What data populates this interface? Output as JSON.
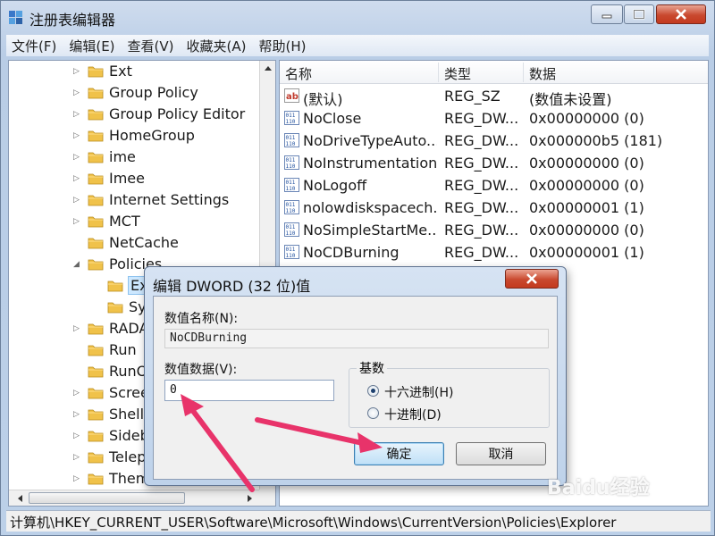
{
  "window": {
    "title": "注册表编辑器",
    "buttons": {
      "minimize": "minimize",
      "maximize": "maximize",
      "close": "close"
    }
  },
  "menu": [
    "文件(F)",
    "编辑(E)",
    "查看(V)",
    "收藏夹(A)",
    "帮助(H)"
  ],
  "tree": {
    "items": [
      {
        "label": "Ext",
        "expander": "▷"
      },
      {
        "label": "Group Policy",
        "expander": "▷"
      },
      {
        "label": "Group Policy Editor",
        "expander": "▷"
      },
      {
        "label": "HomeGroup",
        "expander": "▷"
      },
      {
        "label": "ime",
        "expander": "▷"
      },
      {
        "label": "Imee",
        "expander": "▷"
      },
      {
        "label": "Internet Settings",
        "expander": "▷"
      },
      {
        "label": "MCT",
        "expander": "▷"
      },
      {
        "label": "NetCache",
        "expander": ""
      },
      {
        "label": "Policies",
        "expander": "◢"
      },
      {
        "label": "Ex",
        "expander": "",
        "selected": true
      },
      {
        "label": "Sy",
        "expander": ""
      },
      {
        "label": "RADA",
        "expander": "▷"
      },
      {
        "label": "Run",
        "expander": ""
      },
      {
        "label": "RunO",
        "expander": ""
      },
      {
        "label": "Scree",
        "expander": "▷"
      },
      {
        "label": "Shell",
        "expander": "▷"
      },
      {
        "label": "Sideb",
        "expander": "▷"
      },
      {
        "label": "Telep",
        "expander": "▷"
      },
      {
        "label": "Them",
        "expander": "▷"
      }
    ]
  },
  "list": {
    "headers": {
      "name": "名称",
      "type": "类型",
      "data": "数据"
    },
    "rows": [
      {
        "icon": "string-value-icon",
        "name": "(默认)",
        "type": "REG_SZ",
        "data": "(数值未设置)"
      },
      {
        "icon": "dword-value-icon",
        "name": "NoClose",
        "type": "REG_DW...",
        "data": "0x00000000 (0)"
      },
      {
        "icon": "dword-value-icon",
        "name": "NoDriveTypeAuto...",
        "type": "REG_DW...",
        "data": "0x000000b5 (181)"
      },
      {
        "icon": "dword-value-icon",
        "name": "NoInstrumentation",
        "type": "REG_DW...",
        "data": "0x00000000 (0)"
      },
      {
        "icon": "dword-value-icon",
        "name": "NoLogoff",
        "type": "REG_DW...",
        "data": "0x00000000 (0)"
      },
      {
        "icon": "dword-value-icon",
        "name": "nolowdiskspacech...",
        "type": "REG_DW...",
        "data": "0x00000001 (1)"
      },
      {
        "icon": "dword-value-icon",
        "name": "NoSimpleStartMe...",
        "type": "REG_DW...",
        "data": "0x00000000 (0)"
      },
      {
        "icon": "dword-value-icon",
        "name": "NoCDBurning",
        "type": "REG_DW...",
        "data": "0x00000001 (1)"
      }
    ]
  },
  "status": "计算机\\HKEY_CURRENT_USER\\Software\\Microsoft\\Windows\\CurrentVersion\\Policies\\Explorer",
  "dialog": {
    "title": "编辑 DWORD (32 位)值",
    "name_label": "数值名称(N):",
    "name_value": "NoCDBurning",
    "data_label": "数值数据(V):",
    "data_value": "0",
    "base_label": "基数",
    "hex_label": "十六进制(H)",
    "dec_label": "十进制(D)",
    "hex_selected": true,
    "ok": "确定",
    "cancel": "取消"
  },
  "watermark": "Baidu经验",
  "colors": {
    "annotation_arrow": "#e8336a",
    "selection": "#cde8ff"
  }
}
